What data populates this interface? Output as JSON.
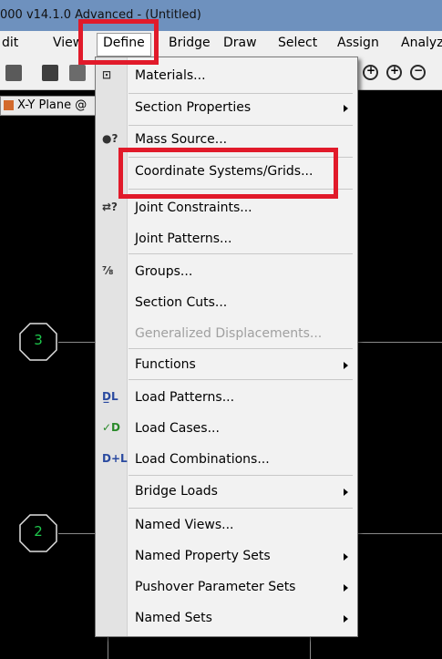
{
  "title": "000 v14.1.0 Advanced - (Untitled)",
  "menubar": [
    "dit",
    "View",
    "Define",
    "Bridge",
    "Draw",
    "Select",
    "Assign",
    "Analyz"
  ],
  "view_tab": "X-Y Plane @",
  "grid_bubbles": [
    "3",
    "2"
  ],
  "dropdown": {
    "items": [
      {
        "label": "Materials...",
        "icon": "materials-icon"
      },
      {
        "label": "Section Properties",
        "submenu": true
      },
      {
        "label": "Mass Source...",
        "icon": "mass-source-icon"
      },
      {
        "label": "Coordinate Systems/Grids..."
      },
      {
        "label": "Joint Constraints...",
        "icon": "joint-constraints-icon"
      },
      {
        "label": "Joint Patterns..."
      },
      {
        "label": "Groups...",
        "icon": "groups-icon"
      },
      {
        "label": "Section Cuts..."
      },
      {
        "label": "Generalized Displacements...",
        "disabled": true
      },
      {
        "label": "Functions",
        "submenu": true
      },
      {
        "label": "Load Patterns...",
        "icon": "load-patterns-icon"
      },
      {
        "label": "Load Cases...",
        "icon": "load-cases-icon"
      },
      {
        "label": "Load Combinations...",
        "icon": "load-combinations-icon"
      },
      {
        "label": "Bridge Loads",
        "submenu": true
      },
      {
        "label": "Named Views..."
      },
      {
        "label": "Named Property Sets",
        "submenu": true
      },
      {
        "label": "Pushover Parameter Sets",
        "submenu": true
      },
      {
        "label": "Named Sets",
        "submenu": true
      }
    ]
  },
  "colors": {
    "highlight": "#e11a2a",
    "grid_bubble": "#1ec84c",
    "title_bar": "#6e91be"
  }
}
